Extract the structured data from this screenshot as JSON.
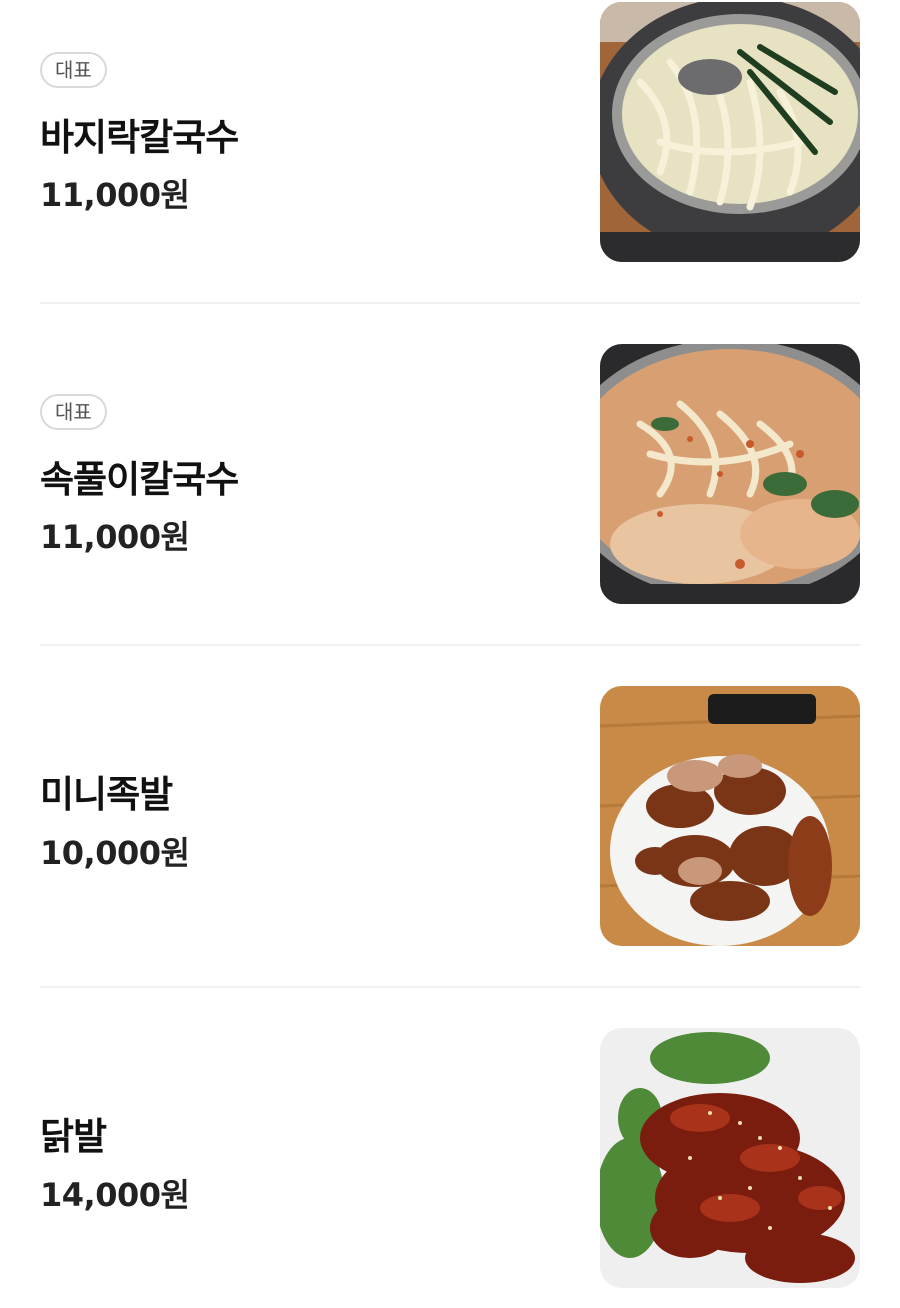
{
  "menu": {
    "items": [
      {
        "badge": "대표",
        "name": "바지락칼국수",
        "price": "11,000원",
        "image": "clam-kalguksu-photo"
      },
      {
        "badge": "대표",
        "name": "속풀이칼국수",
        "price": "11,000원",
        "image": "spicy-kalguksu-photo"
      },
      {
        "badge": "",
        "name": "미니족발",
        "price": "10,000원",
        "image": "mini-jokbal-photo"
      },
      {
        "badge": "",
        "name": "닭발",
        "price": "14,000원",
        "image": "chicken-feet-photo"
      }
    ]
  }
}
